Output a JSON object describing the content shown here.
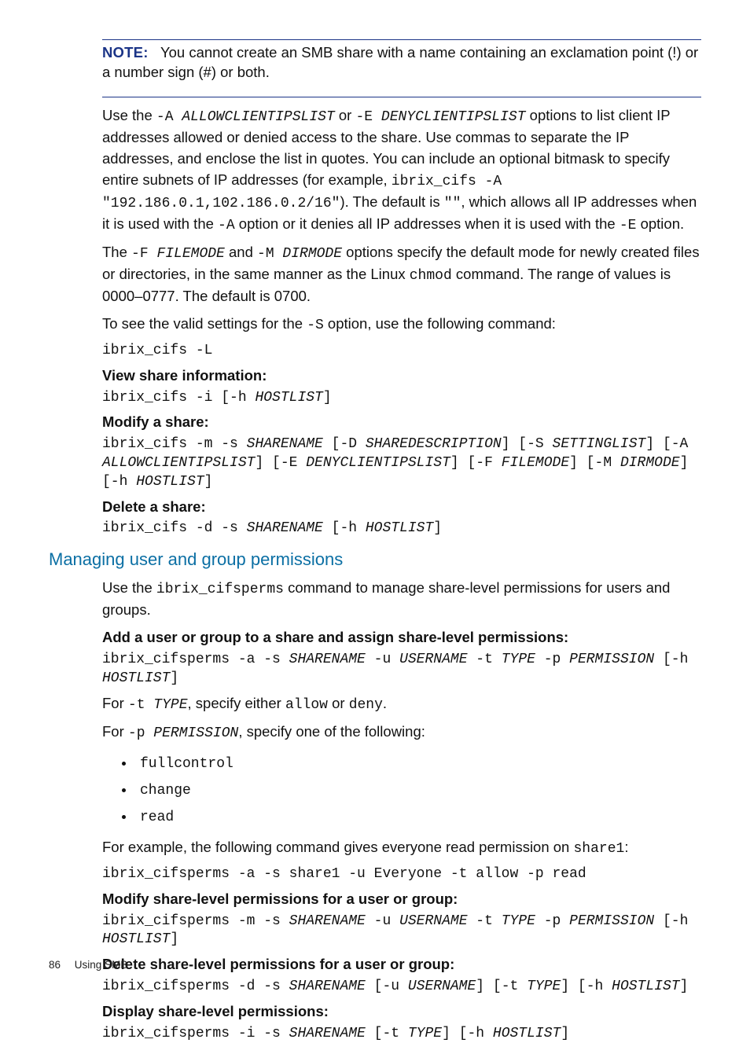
{
  "note": {
    "label": "NOTE:",
    "body_full": "You cannot create an SMB share with a name containing an exclamation point (!) or a number sign (#) or both."
  },
  "p1": {
    "a": "Use the ",
    "code1": "-A ",
    "codei1": "ALLOWCLIENTIPSLIST",
    "b": " or ",
    "code2": "-E ",
    "codei2": "DENYCLIENTIPSLIST",
    "c": " options to list client IP addresses allowed or denied access to the share. Use commas to separate the IP addresses, and enclose the list in quotes. You can include an optional bitmask to specify entire subnets of IP addresses (for example, ",
    "code3": "ibrix_cifs -A \"192.186.0.1,102.186.0.2/16\"",
    "d": "). The default is ",
    "code4": "\"\"",
    "e": ", which allows all IP addresses when it is used with the ",
    "code5": "-A",
    "f": " option or it denies all IP addresses when it is used with the ",
    "code6": "-E",
    "g": " option."
  },
  "p2": {
    "a": "The ",
    "code1": "-F ",
    "codei1": "FILEMODE",
    "b": " and ",
    "code2": "-M ",
    "codei2": "DIRMODE",
    "c": " options specify the default mode for newly created files or directories, in the same manner as the Linux ",
    "code3": "chmod",
    "d": " command. The range of values is 0000–0777. The default is 0700."
  },
  "p3": {
    "a": "To see the valid settings for the ",
    "code1": "-S",
    "b": " option, use the following command:"
  },
  "cmd_list": "ibrix_cifs -L",
  "h_view": "View share information:",
  "cmd_view_a": "ibrix_cifs -i [-h ",
  "cmd_view_i": "HOSTLIST",
  "cmd_view_b": "]",
  "h_modify": "Modify a share:",
  "cmd_modify": {
    "t1": "ibrix_cifs -m -s ",
    "i1": "SHARENAME",
    "t2": " [-D ",
    "i2": "SHAREDESCRIPTION",
    "t3": "] [-S ",
    "i3": "SETTINGLIST",
    "t4": "] [-A ",
    "i4": "ALLOWCLIENTIPSLIST",
    "t5": "] [-E ",
    "i5": "DENYCLIENTIPSLIST",
    "t6": "] [-F ",
    "i6": "FILEMODE",
    "t7": "] [-M ",
    "i7": "DIRMODE",
    "t8": "] [-h ",
    "i8": "HOSTLIST",
    "t9": "]"
  },
  "h_delete": "Delete a share:",
  "cmd_delete": {
    "t1": "ibrix_cifs -d -s ",
    "i1": "SHARENAME",
    "t2": " [-h ",
    "i2": "HOSTLIST",
    "t3": "]"
  },
  "section_title": "Managing user and group permissions",
  "p_use": {
    "a": "Use the ",
    "code1": "ibrix_cifsperms",
    "b": " command to manage share-level permissions for users and groups."
  },
  "h_add": "Add a user or group to a share and assign share-level permissions:",
  "cmd_add": {
    "t1": "ibrix_cifsperms -a -s ",
    "i1": "SHARENAME",
    "t2": " -u ",
    "i2": "USERNAME",
    "t3": " -t ",
    "i3": "TYPE",
    "t4": " -p ",
    "i4": "PERMISSION",
    "t5": " [-h ",
    "i5": "HOSTLIST",
    "t6": "]"
  },
  "p_t": {
    "a": "For ",
    "code1": "-t ",
    "codei1": "TYPE",
    "b": ", specify either ",
    "code2": "allow",
    "c": " or ",
    "code3": "deny",
    "d": "."
  },
  "p_p": {
    "a": "For ",
    "code1": "-p ",
    "codei1": "PERMISSION",
    "b": ", specify one of the following:"
  },
  "perm": {
    "full": "fullcontrol",
    "change": "change",
    "read": "read"
  },
  "p_example": {
    "a": "For example, the following command gives everyone read permission on ",
    "code1": "share1",
    "b": ":"
  },
  "cmd_example": "ibrix_cifsperms -a -s share1 -u Everyone -t allow -p read",
  "h_modify_perm": "Modify share-level permissions for a user or group:",
  "cmd_modify_perm": {
    "t1": "ibrix_cifsperms -m -s ",
    "i1": "SHARENAME",
    "t2": " -u ",
    "i2": "USERNAME",
    "t3": " -t ",
    "i3": "TYPE",
    "t4": " -p ",
    "i4": "PERMISSION",
    "t5": " [-h ",
    "i5": "HOSTLIST",
    "t6": "]"
  },
  "h_delete_perm": "Delete share-level permissions for a user or group:",
  "cmd_delete_perm": {
    "t1": "ibrix_cifsperms -d -s ",
    "i1": "SHARENAME",
    "t2": " [-u ",
    "i2": "USERNAME",
    "t3": "] [-t ",
    "i3": "TYPE",
    "t4": "] [-h ",
    "i4": "HOSTLIST",
    "t5": "]"
  },
  "h_display_perm": "Display share-level permissions:",
  "cmd_display_perm": {
    "t1": "ibrix_cifsperms -i -s ",
    "i1": "SHARENAME",
    "t2": " [-t ",
    "i2": "TYPE",
    "t3": "] [-h ",
    "i3": "HOSTLIST",
    "t4": "]"
  },
  "footer": {
    "page": "86",
    "title": "Using SMB"
  }
}
